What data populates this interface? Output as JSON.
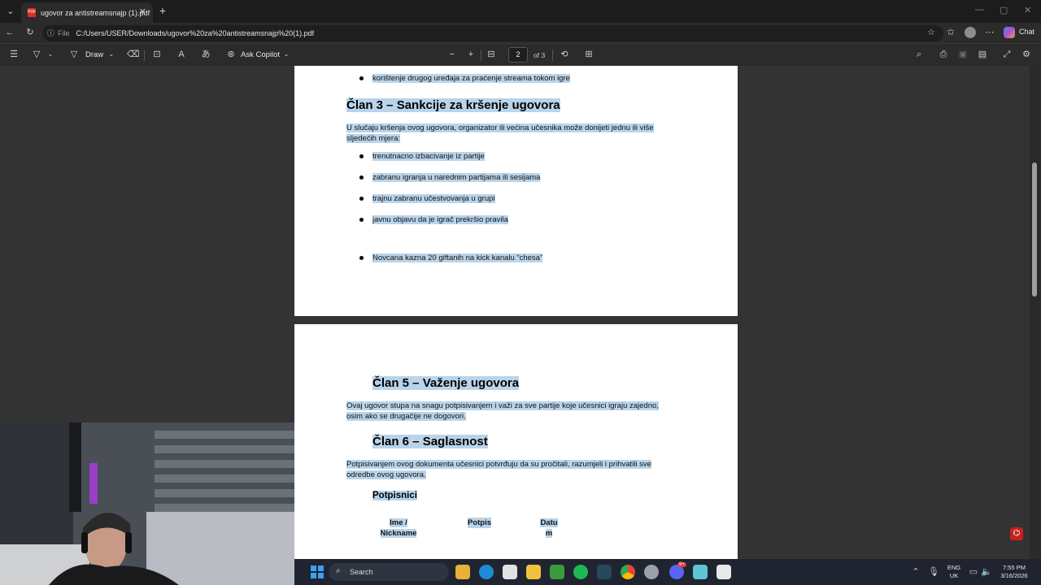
{
  "browser": {
    "tab_title": "ugovor za antistreamsnajp (1).pdf",
    "address_label": "File",
    "url": "C:/Users/USER/Downloads/ugovor%20za%20antistreamsnajp%20(1).pdf",
    "chat_label": "Chat",
    "pdf_favicon_text": "PDF"
  },
  "pdf_toolbar": {
    "draw_label": "Draw",
    "copilot_label": "Ask Copilot",
    "page_current": "2",
    "page_total": "of 3"
  },
  "page1": {
    "top_bullet": "korištenje drugog uređaja za praćenje streama tokom igre",
    "heading": "Član 3 – Sankcije za kršenje ugovora",
    "para_line1": "U slučaju kršenja ovog ugovora, organizator ili većina učesnika može donijeti jednu ili više",
    "para_line2": "sljedećih mjera:",
    "bullets": [
      "trenutnacno izbacivanje iz partije",
      "zabranu igranja u narednim partijama ili sesijama",
      "trajnu zabranu učestvovanja u grupi",
      "javnu objavu da je igrač prekršio pravila",
      "Novcana kazna 20 giftanih na kick kanalu “chesa”"
    ]
  },
  "page2": {
    "heading5": "Član 5 – Važenje ugovora",
    "para5_line1": "Ovaj ugovor stupa na snagu potpisivanjem i važi za sve partije koje učesnici igraju zajedno,",
    "para5_line2": "osim ako se drugačije ne dogovori.",
    "heading6": "Član 6 – Saglasnost",
    "para6_line1": "Potpisivanjem ovog dokumenta učesnici potvrđuju da su pročitali, razumjeli i prihvatili sve",
    "para6_line2": "odredbe ovog ugovora.",
    "signers_heading": "Potpisnici",
    "col1_line1": "Ime /",
    "col1_line2": "Nickname",
    "col2": "Potpis",
    "col3_line1": "Datu",
    "col3_line2": "m"
  },
  "taskbar": {
    "search_label": "Search",
    "lang_line1": "ENG",
    "lang_line2": "UK",
    "time": "7:55 PM",
    "date": "3/16/2026",
    "discord_badge": "9+"
  },
  "colors": {
    "selection": "#b9d4ea",
    "viewer_bg": "#333333",
    "chrome_bg": "#2b2b2b",
    "taskbar_bg": "#1f2430"
  }
}
